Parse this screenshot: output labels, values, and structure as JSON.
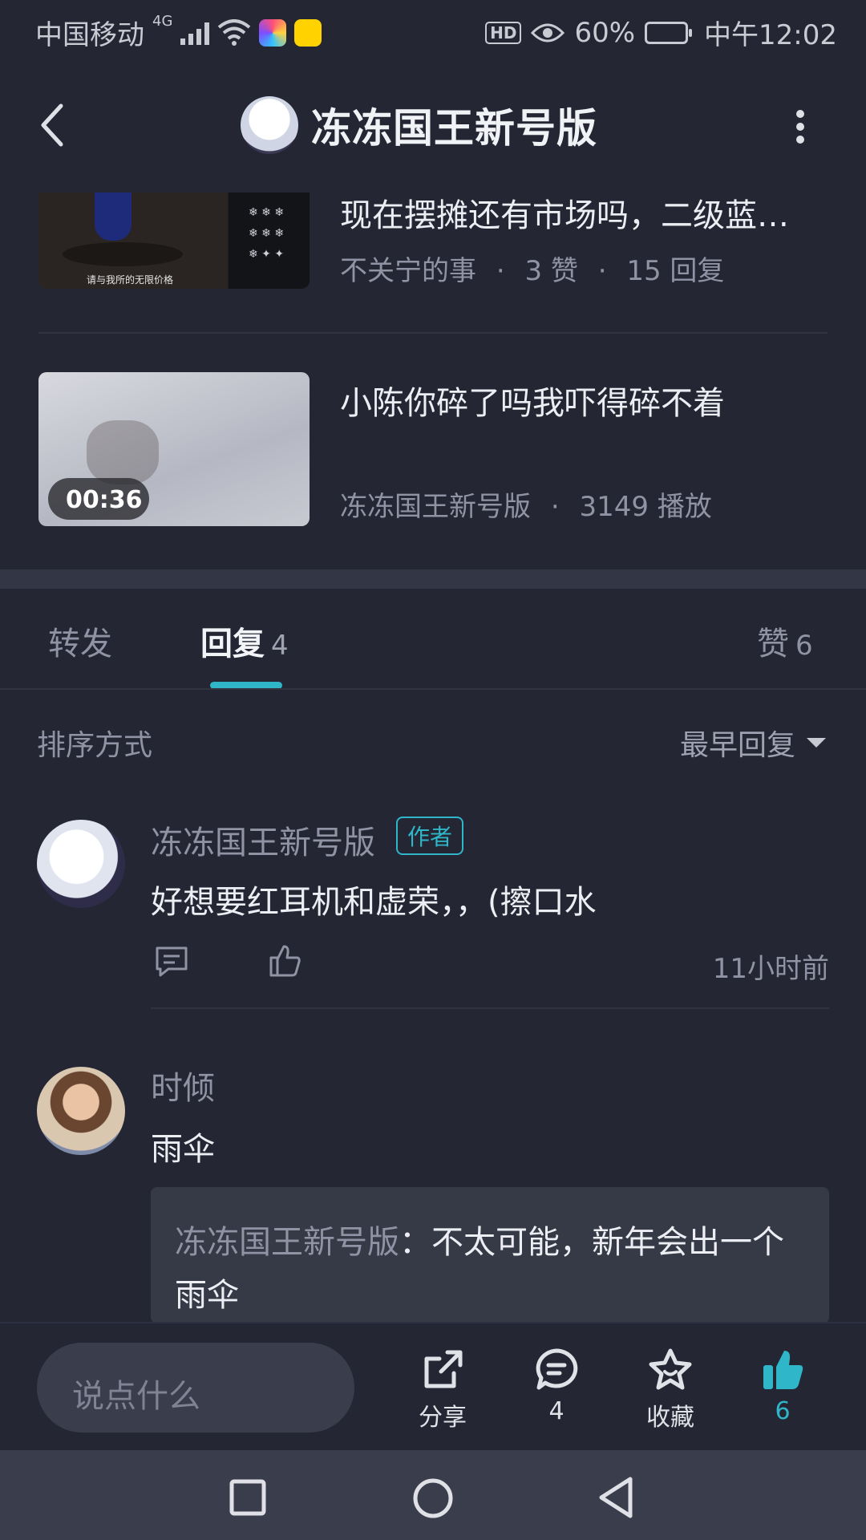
{
  "status_bar": {
    "carrier": "中国移动",
    "network": "4G",
    "battery": "60%",
    "time": "中午12:02",
    "hd": "HD"
  },
  "header": {
    "title": "冻冻国王新号版"
  },
  "related": [
    {
      "title": "现在摆摊还有市场吗，二级蓝…",
      "author": "不关宁的事",
      "likes": "3 赞",
      "replies": "15 回复",
      "thumb_caption": "请与我所的无限价格"
    },
    {
      "title": "小陈你碎了吗我吓得碎不着",
      "author": "冻冻国王新号版",
      "plays": "3149 播放",
      "duration": "00:36"
    }
  ],
  "tabs": {
    "forward": "转发",
    "reply": "回复",
    "reply_count": "4",
    "like": "赞",
    "like_count": "6"
  },
  "sort": {
    "label": "排序方式",
    "value": "最早回复"
  },
  "comments": [
    {
      "name": "冻冻国王新号版",
      "badge": "作者",
      "text": "好想要红耳机和虚荣，，(擦口水",
      "time": "11小时前"
    },
    {
      "name": "时倾",
      "text": "雨伞",
      "reply_name": "冻冻国王新号版",
      "reply_sep": "：",
      "reply_text": "不太可能，新年会出一个雨伞"
    }
  ],
  "bottom_bar": {
    "input_placeholder": "说点什么",
    "share": "分享",
    "comment_count": "4",
    "favorite": "收藏",
    "like_count": "6",
    "accent": "#2fb6c8"
  }
}
